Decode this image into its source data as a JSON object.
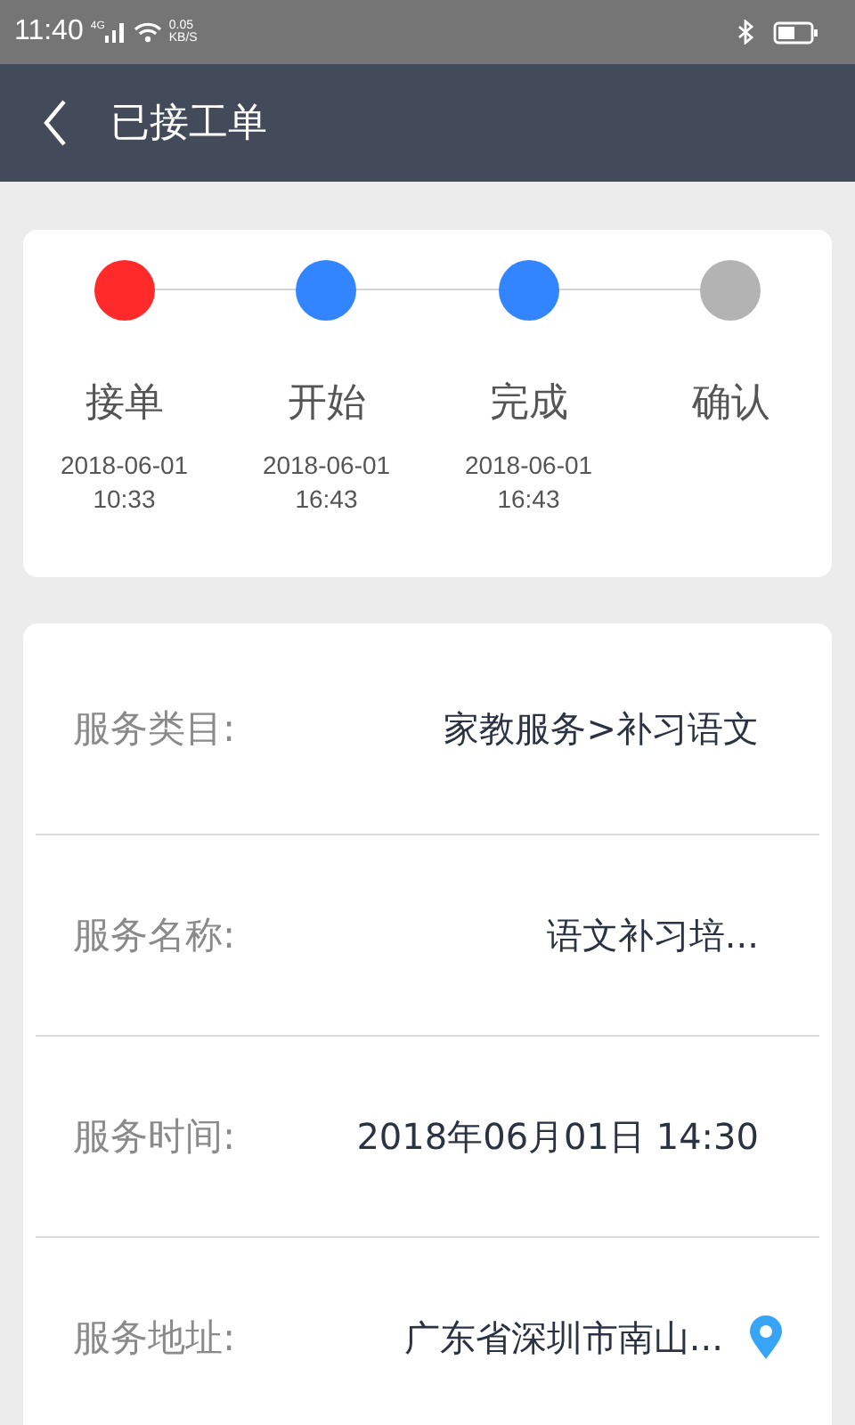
{
  "status_bar": {
    "time": "11:40",
    "network": "4G",
    "speed": "0.05",
    "speed_unit": "KB/S"
  },
  "header": {
    "title": "已接工单"
  },
  "steps": [
    {
      "label": "接单",
      "date": "2018-06-01",
      "time": "10:33",
      "color": "#ff2a2a"
    },
    {
      "label": "开始",
      "date": "2018-06-01",
      "time": "16:43",
      "color": "#3385ff"
    },
    {
      "label": "完成",
      "date": "2018-06-01",
      "time": "16:43",
      "color": "#3385ff"
    },
    {
      "label": "确认",
      "color": "#b3b3b3"
    }
  ],
  "details": [
    {
      "label": "服务类目:",
      "value": "家教服务>补习语文"
    },
    {
      "label": "服务名称:",
      "value": "语文补习培..."
    },
    {
      "label": "服务时间:",
      "value": "2018年06月01日 14:30"
    },
    {
      "label": "服务地址:",
      "value": "广东省深圳市南山...",
      "kind": "location"
    }
  ]
}
